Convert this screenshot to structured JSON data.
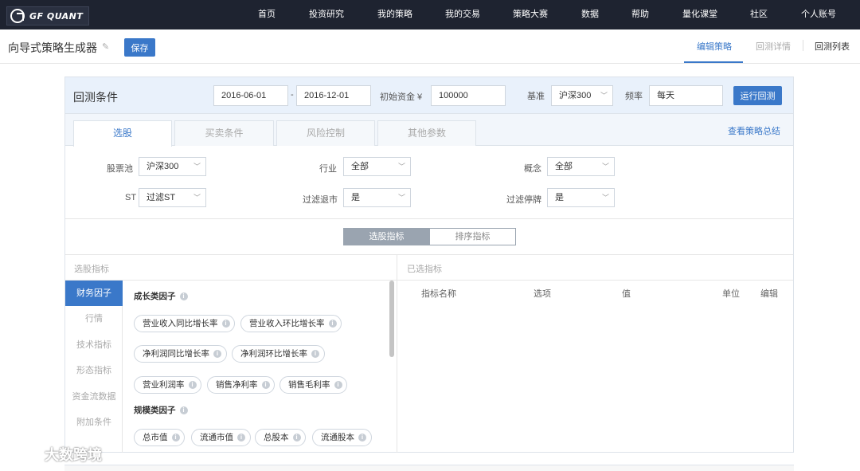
{
  "app": {
    "logo_text": "GF QUANT",
    "nav": [
      "首页",
      "投资研究",
      "我的策略",
      "我的交易",
      "策略大赛",
      "数据",
      "帮助",
      "量化课堂",
      "社区",
      "个人账号"
    ]
  },
  "titlebar": {
    "title": "向导式策略生成器",
    "save_label": "保存",
    "tabs": [
      "编辑策略",
      "回测详情",
      "回测列表"
    ]
  },
  "backtest": {
    "title": "回测条件",
    "start_date": "2016-06-01",
    "dash": "-",
    "end_date": "2016-12-01",
    "capital_label": "初始资金 ¥",
    "capital": "100000",
    "benchmark_label": "基准",
    "benchmark": "沪深300",
    "frequency_label": "频率",
    "frequency": "每天",
    "run_label": "运行回测"
  },
  "tabs": [
    "选股",
    "买卖条件",
    "风险控制",
    "其他参数"
  ],
  "summary_link": "查看策略总结",
  "filters": {
    "pool_label": "股票池",
    "pool_value": "沪深300",
    "industry_label": "行业",
    "industry_value": "全部",
    "concept_label": "概念",
    "concept_value": "全部",
    "st_label": "ST",
    "st_value": "过滤ST",
    "delist_label": "过滤退市",
    "delist_value": "是",
    "suspend_label": "过滤停牌",
    "suspend_value": "是"
  },
  "segments": [
    "选股指标",
    "排序指标"
  ],
  "left_pane": {
    "head": "选股指标",
    "categories": [
      "财务因子",
      "行情",
      "技术指标",
      "形态指标",
      "资金流数据",
      "附加条件"
    ],
    "groups": [
      {
        "title": "成长类因子",
        "chips": [
          "营业收入同比增长率",
          "营业收入环比增长率",
          "净利润同比增长率",
          "净利润环比增长率",
          "营业利润率",
          "销售净利率",
          "销售毛利率"
        ]
      },
      {
        "title": "规模类因子",
        "chips": [
          "总市值",
          "流通市值",
          "总股本",
          "流通股本"
        ]
      }
    ]
  },
  "right_pane": {
    "head": "已选指标",
    "columns": [
      "指标名称",
      "选项",
      "值",
      "单位",
      "编辑"
    ]
  },
  "watermark": "大数跨境"
}
